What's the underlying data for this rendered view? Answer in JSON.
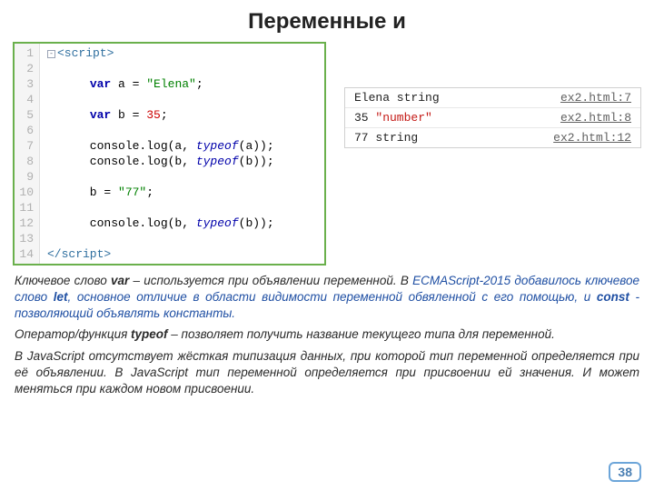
{
  "title": "Переменные и",
  "code": {
    "lines": [
      {
        "n": "1",
        "html": "<span class='fold'>-</span><span class='tag'>&lt;script&gt;</span>"
      },
      {
        "n": "2",
        "html": ""
      },
      {
        "n": "3",
        "html": "      <span class='kw'>var</span> a = <span class='str'>\"Elena\"</span>;"
      },
      {
        "n": "4",
        "html": ""
      },
      {
        "n": "5",
        "html": "      <span class='kw'>var</span> b = <span class='num'>35</span>;"
      },
      {
        "n": "6",
        "html": ""
      },
      {
        "n": "7",
        "html": "      console.log(a, <span class='lit'>typeof</span>(a));"
      },
      {
        "n": "8",
        "html": "      console.log(b, <span class='lit'>typeof</span>(b));"
      },
      {
        "n": "9",
        "html": ""
      },
      {
        "n": "10",
        "html": "      b = <span class='str'>\"77\"</span>;"
      },
      {
        "n": "11",
        "html": ""
      },
      {
        "n": "12",
        "html": "      console.log(b, <span class='lit'>typeof</span>(b));"
      },
      {
        "n": "13",
        "html": ""
      },
      {
        "n": "14",
        "html": "<span class='tag'>&lt;/script&gt;</span>"
      }
    ]
  },
  "console": [
    {
      "out": "Elena string",
      "src": "ex2.html:7"
    },
    {
      "out": "35 <span class='red'>\"number\"</span>",
      "src": "ex2.html:8"
    },
    {
      "out": "77 string",
      "src": "ex2.html:12"
    }
  ],
  "paras": {
    "p1_a": "Ключевое слово ",
    "p1_var": "var",
    "p1_b": " – используется при объявлении переменной. В ",
    "p1_ecma": "ECMAScript-2015",
    "p1_c": " добавилось ключевое слово ",
    "p1_let": "let",
    "p1_d": ", основное отличие в области видимости переменной обвяленной с его помощью, и ",
    "p1_const": "const",
    "p1_e": "  - позволяющий объявлять константы.",
    "p2_a": "Оператор/функция ",
    "p2_typeof": "typeof",
    "p2_b": " – позволяет получить название текущего типа для переменной.",
    "p3": "В JavaScript отсутствует жёсткая типизация данных, при которой тип переменной определяется при её объявлении. В JavaScript тип переменной определяется при присвоении ей значения. И может меняться при каждом новом присвоении."
  },
  "pagenum": "38"
}
